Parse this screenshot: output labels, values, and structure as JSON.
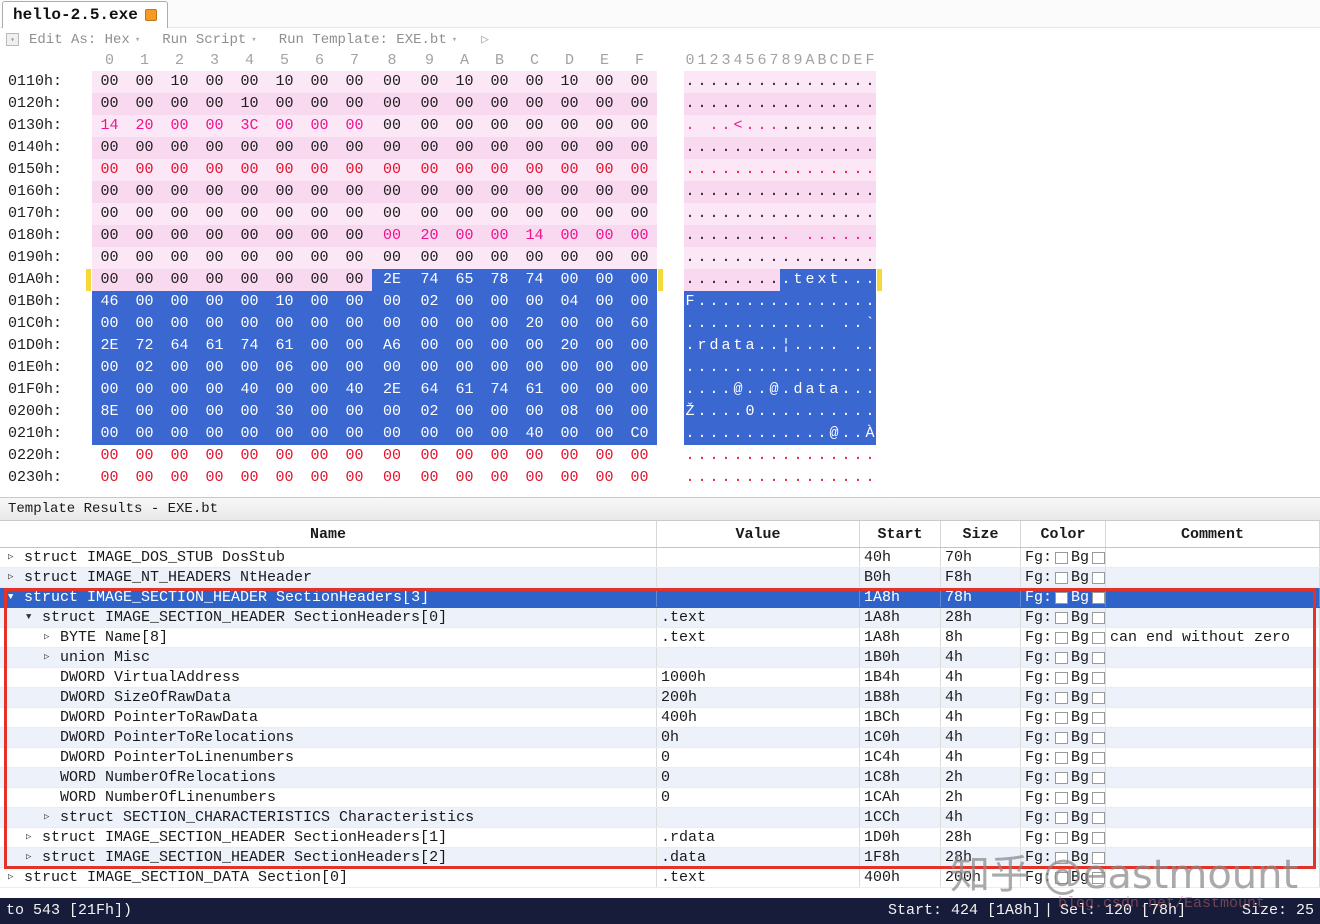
{
  "window": {
    "tab_title": "hello-2.5.exe"
  },
  "toolbar": {
    "edit_as": "Edit As: Hex",
    "run_script": "Run Script",
    "run_template": "Run Template: EXE.bt"
  },
  "hex_view": {
    "col_header_hex": [
      "0",
      "1",
      "2",
      "3",
      "4",
      "5",
      "6",
      "7",
      "8",
      "9",
      "A",
      "B",
      "C",
      "D",
      "E",
      "F"
    ],
    "col_header_ascii": "0123456789ABCDEF",
    "rows": [
      {
        "addr": "0110h:",
        "cls": "pA",
        "bytes": "00 00 10 00 00 10 00 00 00 00 10 00 00 10 00 00",
        "ascii": "................"
      },
      {
        "addr": "0120h:",
        "cls": "pB",
        "bytes": "00 00 00 00 10 00 00 00 00 00 00 00 00 00 00 00",
        "ascii": "................"
      },
      {
        "addr": "0130h:",
        "cls": "pA",
        "bytes": "14 20 00 00 3C 00 00 00 00 00 00 00 00 00 00 00",
        "ascii": ". ..<...........",
        "marks": [
          [
            0,
            7,
            "mag"
          ]
        ]
      },
      {
        "addr": "0140h:",
        "cls": "pB",
        "bytes": "00 00 00 00 00 00 00 00 00 00 00 00 00 00 00 00",
        "ascii": "................"
      },
      {
        "addr": "0150h:",
        "cls": "pA",
        "bytes": "00 00 00 00 00 00 00 00 00 00 00 00 00 00 00 00",
        "ascii": "................",
        "marks": [
          [
            0,
            15,
            "red"
          ]
        ]
      },
      {
        "addr": "0160h:",
        "cls": "pB",
        "bytes": "00 00 00 00 00 00 00 00 00 00 00 00 00 00 00 00",
        "ascii": "................"
      },
      {
        "addr": "0170h:",
        "cls": "pA",
        "bytes": "00 00 00 00 00 00 00 00 00 00 00 00 00 00 00 00",
        "ascii": "................"
      },
      {
        "addr": "0180h:",
        "cls": "pB",
        "bytes": "00 00 00 00 00 00 00 00 00 20 00 00 14 00 00 00",
        "ascii": "......... ......",
        "marks": [
          [
            8,
            15,
            "mag"
          ]
        ]
      },
      {
        "addr": "0190h:",
        "cls": "pA",
        "bytes": "00 00 00 00 00 00 00 00 00 00 00 00 00 00 00 00",
        "ascii": "................"
      },
      {
        "addr": "01A0h:",
        "cls": "pB",
        "bytes": "00 00 00 00 00 00 00 00 2E 74 65 78 74 00 00 00",
        "ascii": ".........text...",
        "marks": [
          [
            8,
            15,
            "sel"
          ]
        ],
        "ym": true
      },
      {
        "addr": "01B0h:",
        "cls": "pA",
        "bytes": "46 00 00 00 00 10 00 00 00 02 00 00 00 04 00 00",
        "ascii": "F...............",
        "marks": [
          [
            0,
            15,
            "sel"
          ]
        ]
      },
      {
        "addr": "01C0h:",
        "cls": "pB",
        "bytes": "00 00 00 00 00 00 00 00 00 00 00 00 20 00 00 60",
        "ascii": "............ ..`",
        "marks": [
          [
            0,
            15,
            "sel"
          ]
        ]
      },
      {
        "addr": "01D0h:",
        "cls": "pA",
        "bytes": "2E 72 64 61 74 61 00 00 A6 00 00 00 00 20 00 00",
        "ascii": ".rdata..¦.... ..",
        "marks": [
          [
            0,
            15,
            "sel"
          ]
        ]
      },
      {
        "addr": "01E0h:",
        "cls": "pB",
        "bytes": "00 02 00 00 00 06 00 00 00 00 00 00 00 00 00 00",
        "ascii": "................",
        "marks": [
          [
            0,
            15,
            "sel"
          ]
        ]
      },
      {
        "addr": "01F0h:",
        "cls": "pA",
        "bytes": "00 00 00 00 40 00 00 40 2E 64 61 74 61 00 00 00",
        "ascii": "....@..@.data...",
        "marks": [
          [
            0,
            15,
            "sel"
          ]
        ]
      },
      {
        "addr": "0200h:",
        "cls": "pB",
        "bytes": "8E 00 00 00 00 30 00 00 00 02 00 00 00 08 00 00",
        "ascii": "Ž....0..........",
        "marks": [
          [
            0,
            15,
            "sel"
          ]
        ]
      },
      {
        "addr": "0210h:",
        "cls": "pA",
        "bytes": "00 00 00 00 00 00 00 00 00 00 00 00 40 00 00 C0",
        "ascii": "............@..À",
        "marks": [
          [
            0,
            15,
            "sel"
          ]
        ]
      },
      {
        "addr": "0220h:",
        "cls": "w",
        "bytes": "00 00 00 00 00 00 00 00 00 00 00 00 00 00 00 00",
        "ascii": "................",
        "marks": [
          [
            0,
            15,
            "red"
          ]
        ]
      },
      {
        "addr": "0230h:",
        "cls": "w",
        "bytes": "00 00 00 00 00 00 00 00 00 00 00 00 00 00 00 00",
        "ascii": "................",
        "marks": [
          [
            0,
            15,
            "red"
          ]
        ]
      }
    ]
  },
  "template_results": {
    "title": "Template Results - EXE.bt",
    "columns": [
      "Name",
      "Value",
      "Start",
      "Size",
      "Color",
      "Comment"
    ],
    "color_labels": {
      "fg": "Fg:",
      "bg": "Bg"
    },
    "rows": [
      {
        "level": 0,
        "arrow": "right",
        "name": "struct IMAGE_DOS_STUB DosStub",
        "value": "",
        "start": "40h",
        "size": "70h",
        "comment": ""
      },
      {
        "level": 0,
        "arrow": "right",
        "name": "struct IMAGE_NT_HEADERS NtHeader",
        "value": "",
        "start": "B0h",
        "size": "F8h",
        "comment": ""
      },
      {
        "level": 0,
        "arrow": "down",
        "name": "struct IMAGE_SECTION_HEADER SectionHeaders[3]",
        "value": "",
        "start": "1A8h",
        "size": "78h",
        "comment": "",
        "selected": true
      },
      {
        "level": 1,
        "arrow": "down",
        "name": "struct IMAGE_SECTION_HEADER SectionHeaders[0]",
        "value": ".text",
        "start": "1A8h",
        "size": "28h",
        "comment": ""
      },
      {
        "level": 2,
        "arrow": "right",
        "name": "BYTE Name[8]",
        "value": ".text",
        "start": "1A8h",
        "size": "8h",
        "comment": "can end without zero"
      },
      {
        "level": 2,
        "arrow": "right",
        "name": "union Misc",
        "value": "",
        "start": "1B0h",
        "size": "4h",
        "comment": ""
      },
      {
        "level": 2,
        "arrow": null,
        "name": "DWORD VirtualAddress",
        "value": "1000h",
        "start": "1B4h",
        "size": "4h",
        "comment": ""
      },
      {
        "level": 2,
        "arrow": null,
        "name": "DWORD SizeOfRawData",
        "value": "200h",
        "start": "1B8h",
        "size": "4h",
        "comment": ""
      },
      {
        "level": 2,
        "arrow": null,
        "name": "DWORD PointerToRawData",
        "value": "400h",
        "start": "1BCh",
        "size": "4h",
        "comment": ""
      },
      {
        "level": 2,
        "arrow": null,
        "name": "DWORD PointerToRelocations",
        "value": "0h",
        "start": "1C0h",
        "size": "4h",
        "comment": ""
      },
      {
        "level": 2,
        "arrow": null,
        "name": "DWORD PointerToLinenumbers",
        "value": "0",
        "start": "1C4h",
        "size": "4h",
        "comment": ""
      },
      {
        "level": 2,
        "arrow": null,
        "name": "WORD NumberOfRelocations",
        "value": "0",
        "start": "1C8h",
        "size": "2h",
        "comment": ""
      },
      {
        "level": 2,
        "arrow": null,
        "name": "WORD NumberOfLinenumbers",
        "value": "0",
        "start": "1CAh",
        "size": "2h",
        "comment": ""
      },
      {
        "level": 2,
        "arrow": "right",
        "name": "struct SECTION_CHARACTERISTICS Characteristics",
        "value": "",
        "start": "1CCh",
        "size": "4h",
        "comment": ""
      },
      {
        "level": 1,
        "arrow": "right",
        "name": "struct IMAGE_SECTION_HEADER SectionHeaders[1]",
        "value": ".rdata",
        "start": "1D0h",
        "size": "28h",
        "comment": ""
      },
      {
        "level": 1,
        "arrow": "right",
        "name": "struct IMAGE_SECTION_HEADER SectionHeaders[2]",
        "value": ".data",
        "start": "1F8h",
        "size": "28h",
        "comment": ""
      },
      {
        "level": 0,
        "arrow": "right",
        "name": "struct IMAGE_SECTION_DATA Section[0]",
        "value": ".text",
        "start": "400h",
        "size": "200h",
        "comment": ""
      }
    ]
  },
  "status_bar": {
    "left": "to 543 [21Fh])",
    "start": "Start: 424 [1A8h]",
    "sep": "|",
    "sel": "Sel: 120 [78h]",
    "size": "Size: 25"
  },
  "watermark": {
    "text": "知乎 @eastmount",
    "sub": "blog.csdn.net/Eastmount"
  },
  "colors": {
    "selection": "#3A67D0",
    "pink_light": "#FCE7F7",
    "pink_dark": "#F9D9F0",
    "red_text": "#E8112D",
    "magenta_text": "#F0128C",
    "annotation_red": "#E53228",
    "status_bg": "#171C3A",
    "marker_yellow": "#F5D839"
  }
}
